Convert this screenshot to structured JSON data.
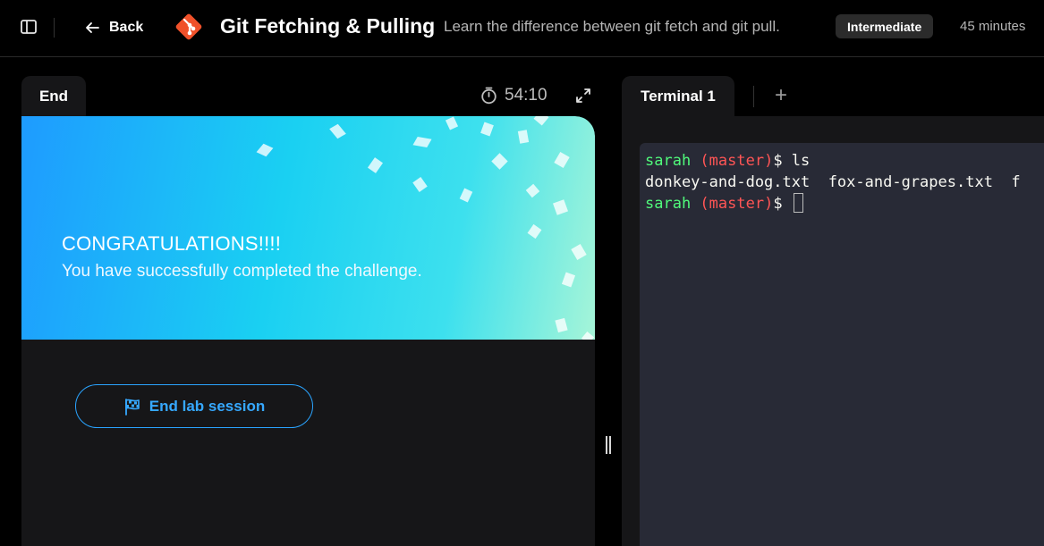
{
  "header": {
    "back_label": "Back",
    "title": "Git Fetching & Pulling",
    "subtitle": "Learn the difference between git fetch and git pull.",
    "level_badge": "Intermediate",
    "duration": "45 minutes",
    "icons": [
      "sidebar-toggle-icon",
      "arrow-left-icon",
      "git-logo"
    ]
  },
  "left_panel": {
    "tab_label": "End",
    "timer": "54:10",
    "banner": {
      "heading": "CONGRATULATIONS!!!!",
      "message": "You have successfully completed the challenge."
    },
    "end_button_label": "End lab session",
    "colors": {
      "accent": "#36a8ff",
      "banner_start": "#1e9bff",
      "banner_end": "#a6f5d8"
    }
  },
  "terminal": {
    "tab_label": "Terminal 1",
    "add_tab_label": "+",
    "lines": [
      {
        "user": "sarah",
        "branch": " (master)",
        "prompt": "$ ",
        "command": "ls"
      },
      {
        "output": "donkey-and-dog.txt  fox-and-grapes.txt  f"
      },
      {
        "user": "sarah",
        "branch": " (master)",
        "prompt": "$ ",
        "command": ""
      }
    ],
    "colors": {
      "user": "#50fa7b",
      "branch": "#ff5555",
      "background": "#282a36"
    }
  }
}
